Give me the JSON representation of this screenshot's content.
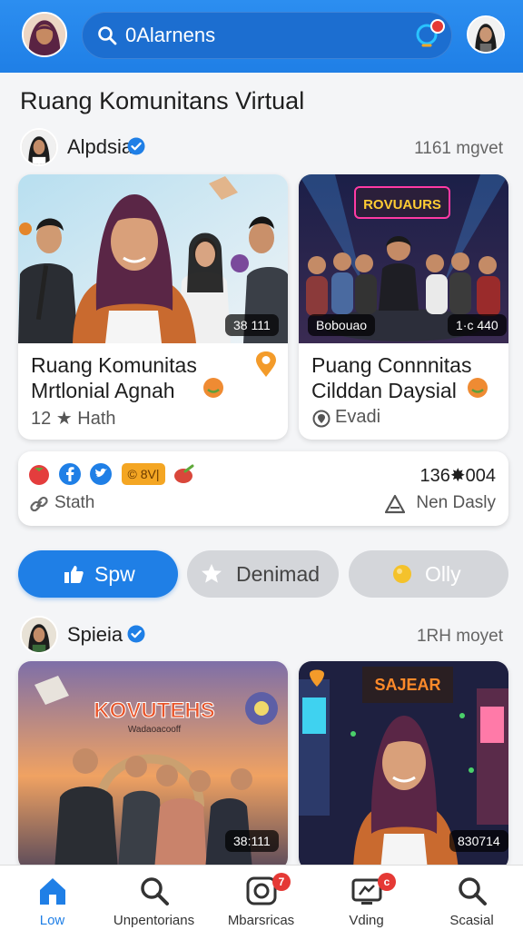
{
  "header": {
    "search_text": "0Alarnens"
  },
  "page_title": "Ruang Komunitans Virtual",
  "feed": [
    {
      "user": {
        "name": "Alpdsia",
        "meta": "1161 mgvet"
      },
      "cards": [
        {
          "badge": "38 111",
          "title_line1": "Ruang Komunitas",
          "title_line2": "Mrtlonial Agnah",
          "sub": "12 ★ Hath"
        },
        {
          "badge": "Bobouao",
          "badge2": "1·c 440",
          "sign": "ROVUAURS",
          "title_line1": "Puang Connnitas",
          "title_line2": "Cilddan Daysial",
          "sub": "Evadi"
        }
      ]
    },
    {
      "user": {
        "name": "Spieia",
        "meta": "1RH moyet"
      },
      "cards": [
        {
          "badge": "38:111",
          "sign": "KOVUTEHS",
          "sign_sub": "Wadaoacooff"
        },
        {
          "badge": "830714",
          "sign": "SAJEAR"
        }
      ]
    }
  ],
  "info": {
    "chip_text": "© 8V|",
    "stat": "136✸004",
    "left": "Stath",
    "right": "Nen Dasly"
  },
  "pills": {
    "primary": "Spw",
    "secondary": "Denimad",
    "tertiary": "Olly"
  },
  "bottom_nav": [
    {
      "label": "Low",
      "active": true
    },
    {
      "label": "Unpentorians"
    },
    {
      "label": "Mbarsricas",
      "badge": "7"
    },
    {
      "label": "Vding",
      "badge": "c"
    },
    {
      "label": "Scasial"
    }
  ],
  "colors": {
    "primary": "#1f7fe6",
    "verified": "#1f7fe6",
    "badge": "#e53935"
  }
}
